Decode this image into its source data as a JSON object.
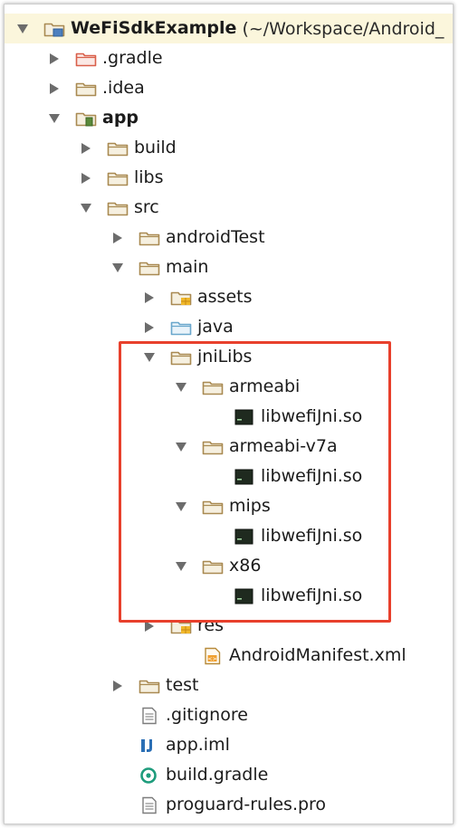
{
  "colors": {
    "folder_stroke": "#a98a52",
    "folder_fill": "#f6f0e0",
    "excluded_stroke": "#d95f4a",
    "source_stroke": "#6aa7cc",
    "source_fill": "#e9f3fa",
    "resource_badge": "#f0b82c",
    "so_file": "#1f2a1f",
    "highlight": "#e8402c",
    "selected_row": "#fbf6dc"
  },
  "tree": [
    {
      "label": "WeFiSdkExample",
      "path": "(~/Workspace/Android_",
      "bold": true,
      "icon": "project-folder",
      "arrow": "expanded",
      "depth": 0,
      "selected": true
    },
    {
      "label": ".gradle",
      "icon": "excluded-folder",
      "arrow": "collapsed",
      "depth": 1
    },
    {
      "label": ".idea",
      "icon": "folder",
      "arrow": "collapsed",
      "depth": 1
    },
    {
      "label": "app",
      "bold": true,
      "icon": "module-folder",
      "arrow": "expanded",
      "depth": 1
    },
    {
      "label": "build",
      "icon": "folder",
      "arrow": "collapsed",
      "depth": 2
    },
    {
      "label": "libs",
      "icon": "folder",
      "arrow": "collapsed",
      "depth": 2
    },
    {
      "label": "src",
      "icon": "folder",
      "arrow": "expanded",
      "depth": 2
    },
    {
      "label": "androidTest",
      "icon": "folder",
      "arrow": "collapsed",
      "depth": 3
    },
    {
      "label": "main",
      "icon": "folder",
      "arrow": "expanded",
      "depth": 3
    },
    {
      "label": "assets",
      "icon": "resource-folder",
      "arrow": "collapsed",
      "depth": 4
    },
    {
      "label": "java",
      "icon": "source-folder",
      "arrow": "collapsed",
      "depth": 4
    },
    {
      "label": "jniLibs",
      "icon": "folder",
      "arrow": "expanded",
      "depth": 4
    },
    {
      "label": "armeabi",
      "icon": "folder",
      "arrow": "expanded",
      "depth": 5
    },
    {
      "label": "libwefiJni.so",
      "icon": "so-file",
      "arrow": "none",
      "depth": 6
    },
    {
      "label": "armeabi-v7a",
      "icon": "folder",
      "arrow": "expanded",
      "depth": 5
    },
    {
      "label": "libwefiJni.so",
      "icon": "so-file",
      "arrow": "none",
      "depth": 6
    },
    {
      "label": "mips",
      "icon": "folder",
      "arrow": "expanded",
      "depth": 5
    },
    {
      "label": "libwefiJni.so",
      "icon": "so-file",
      "arrow": "none",
      "depth": 6
    },
    {
      "label": "x86",
      "icon": "folder",
      "arrow": "expanded",
      "depth": 5
    },
    {
      "label": "libwefiJni.so",
      "icon": "so-file",
      "arrow": "none",
      "depth": 6
    },
    {
      "label": "res",
      "icon": "resource-folder",
      "arrow": "collapsed",
      "depth": 4
    },
    {
      "label": "AndroidManifest.xml",
      "icon": "xml-file",
      "arrow": "none",
      "depth": 5
    },
    {
      "label": "test",
      "icon": "folder",
      "arrow": "collapsed",
      "depth": 3
    },
    {
      "label": ".gitignore",
      "icon": "text-file",
      "arrow": "none",
      "depth": 3
    },
    {
      "label": "app.iml",
      "icon": "iml-file",
      "arrow": "none",
      "depth": 3
    },
    {
      "label": "build.gradle",
      "icon": "gradle-file",
      "arrow": "none",
      "depth": 3
    },
    {
      "label": "proguard-rules.pro",
      "icon": "text-file",
      "arrow": "none",
      "depth": 3
    }
  ]
}
